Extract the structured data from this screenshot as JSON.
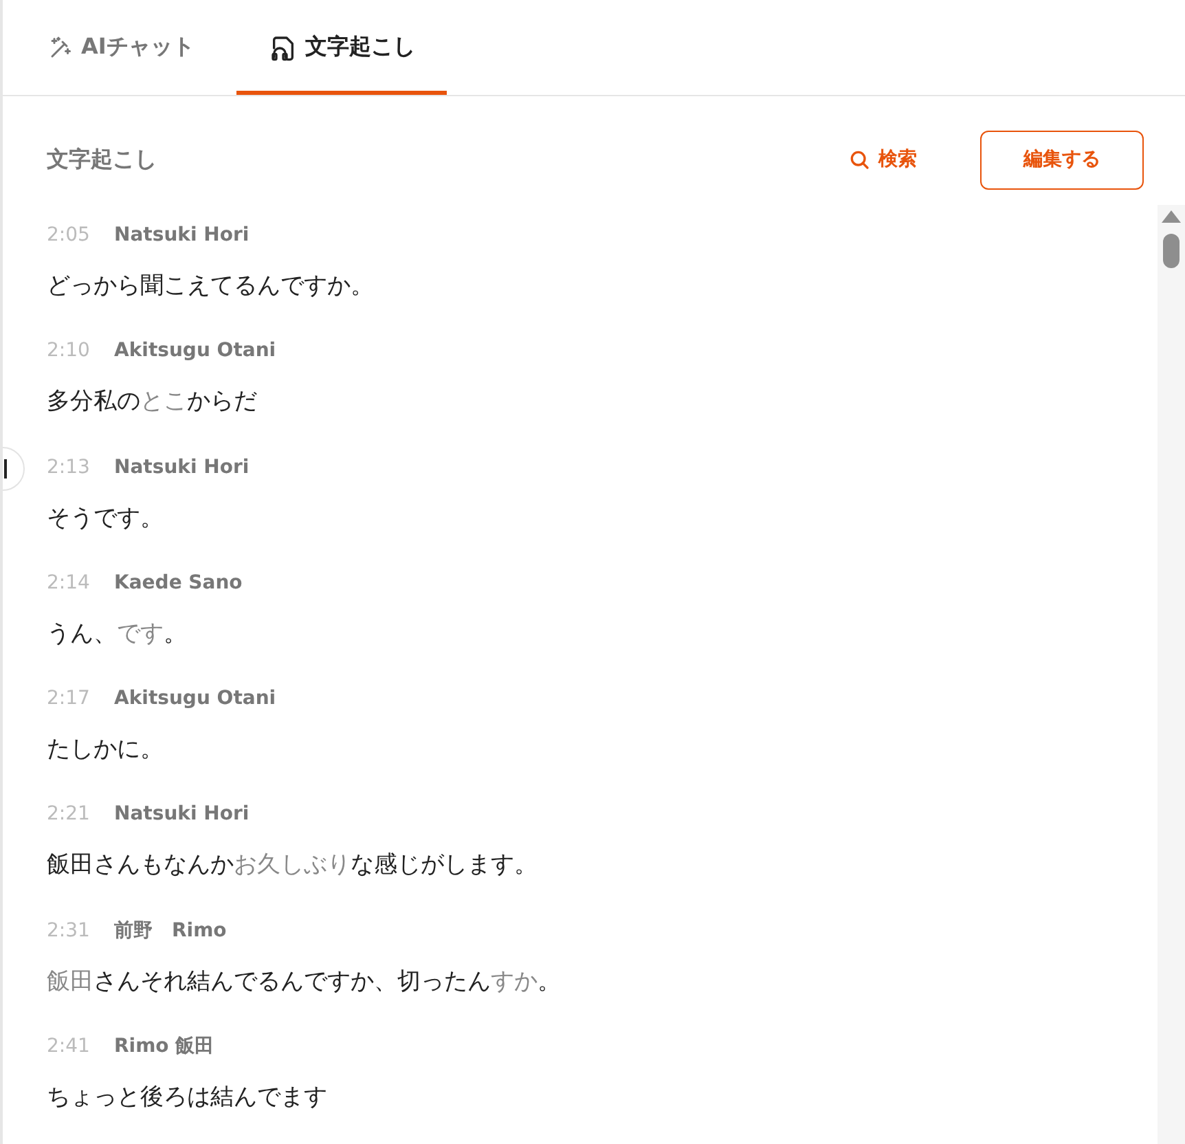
{
  "tabs": [
    {
      "label": "AIチャット",
      "kind": "chat",
      "selected": false
    },
    {
      "label": "文字起こし",
      "kind": "transcript",
      "selected": true
    }
  ],
  "header": {
    "title": "文字起こし",
    "search_label": "検索",
    "edit_button": "編集する"
  },
  "entries": [
    {
      "time": "2:05",
      "speaker": "Natsuki Hori",
      "segments": [
        {
          "text": "どっから聞こえてるんですか。",
          "dim": false
        }
      ]
    },
    {
      "time": "2:10",
      "speaker": "Akitsugu Otani",
      "segments": [
        {
          "text": "多分私の",
          "dim": false
        },
        {
          "text": "とこ",
          "dim": true
        },
        {
          "text": "からだ",
          "dim": false
        }
      ]
    },
    {
      "time": "2:13",
      "speaker": "Natsuki Hori",
      "segments": [
        {
          "text": "そうです。",
          "dim": false
        }
      ]
    },
    {
      "time": "2:14",
      "speaker": "Kaede Sano",
      "segments": [
        {
          "text": "うん、",
          "dim": false
        },
        {
          "text": "です",
          "dim": true
        },
        {
          "text": "。",
          "dim": false
        }
      ]
    },
    {
      "time": "2:17",
      "speaker": "Akitsugu Otani",
      "segments": [
        {
          "text": "たしかに。",
          "dim": false
        }
      ]
    },
    {
      "time": "2:21",
      "speaker": "Natsuki Hori",
      "segments": [
        {
          "text": "飯田さんもなんか",
          "dim": false
        },
        {
          "text": "お久しぶり",
          "dim": true
        },
        {
          "text": "な感じがします。",
          "dim": false
        }
      ]
    },
    {
      "time": "2:31",
      "speaker": "前野　Rimo",
      "segments": [
        {
          "text": "飯田",
          "dim": true
        },
        {
          "text": "さんそれ結んでるんですか、切ったん",
          "dim": false
        },
        {
          "text": "すか",
          "dim": true
        },
        {
          "text": "。",
          "dim": false
        }
      ]
    },
    {
      "time": "2:41",
      "speaker": "Rimo 飯田",
      "segments": [
        {
          "text": "ちょっと後ろは結んでます",
          "dim": false
        }
      ]
    }
  ]
}
